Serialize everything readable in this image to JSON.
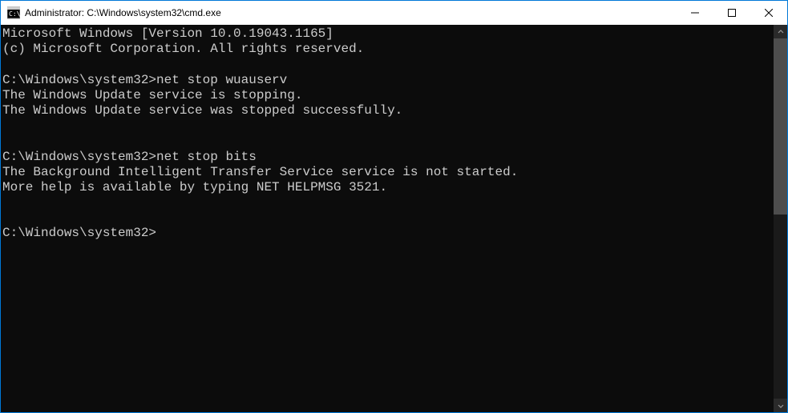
{
  "window": {
    "title": "Administrator: C:\\Windows\\system32\\cmd.exe"
  },
  "terminal": {
    "header_line1": "Microsoft Windows [Version 10.0.19043.1165]",
    "header_line2": "(c) Microsoft Corporation. All rights reserved.",
    "blocks": [
      {
        "prompt": "C:\\Windows\\system32>",
        "command": "net stop wuauserv",
        "output": [
          "The Windows Update service is stopping.",
          "The Windows Update service was stopped successfully."
        ]
      },
      {
        "prompt": "C:\\Windows\\system32>",
        "command": "net stop bits",
        "output": [
          "The Background Intelligent Transfer Service service is not started.",
          "",
          "More help is available by typing NET HELPMSG 3521."
        ]
      }
    ],
    "current_prompt": "C:\\Windows\\system32>"
  }
}
